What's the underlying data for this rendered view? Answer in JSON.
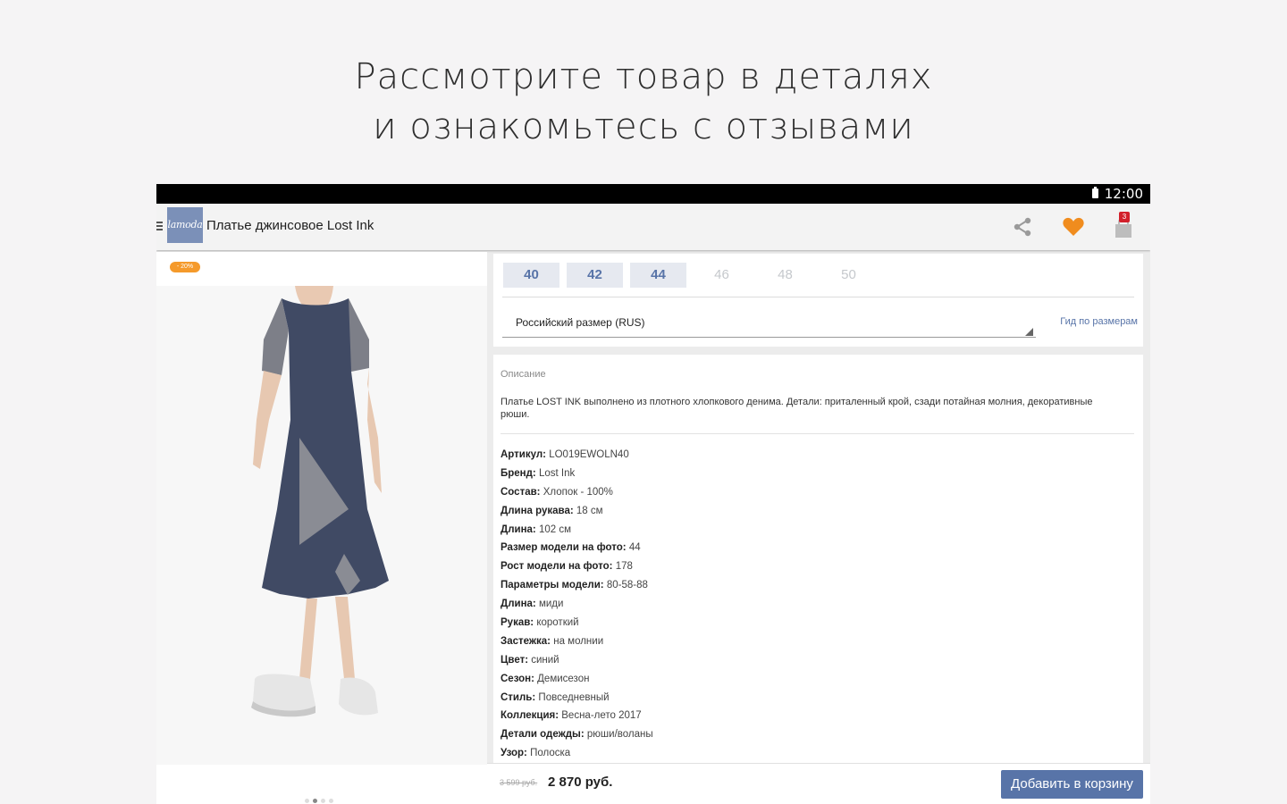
{
  "promo": {
    "line1": "Рассмотрите товар в деталях",
    "line2": "и ознакомьтесь с отзывами"
  },
  "status_bar": {
    "time": "12:00"
  },
  "app_bar": {
    "logo_text": "lamoda",
    "title": "Платье джинсовое Lost Ink",
    "cart_count": "3",
    "icons": [
      "menu-icon",
      "share-icon",
      "heart-icon",
      "cart-icon"
    ],
    "heart_color": "#f08c1e"
  },
  "product": {
    "discount": "- 20%",
    "gallery_pages": 4,
    "gallery_active_page": 2
  },
  "sizes": {
    "options": [
      {
        "label": "40",
        "available": true
      },
      {
        "label": "42",
        "available": true
      },
      {
        "label": "44",
        "available": true
      },
      {
        "label": "46",
        "available": false
      },
      {
        "label": "48",
        "available": false
      },
      {
        "label": "50",
        "available": false
      }
    ],
    "system_label": "Российский размер (RUS)",
    "guide_link": "Гид по размерам"
  },
  "description": {
    "title": "Описание",
    "text": "Платье LOST INK выполнено из плотного хлопкового денима. Детали: приталенный крой, сзади потайная молния, декоративные рюши.",
    "specs": [
      {
        "label": "Артикул:",
        "value": "LO019EWOLN40"
      },
      {
        "label": "Бренд:",
        "value": "Lost Ink"
      },
      {
        "label": "Состав:",
        "value": "Хлопок - 100%"
      },
      {
        "label": "Длина рукава:",
        "value": "18 см"
      },
      {
        "label": "Длина:",
        "value": "102 см"
      },
      {
        "label": "Размер модели на фото:",
        "value": "44"
      },
      {
        "label": "Рост модели на фото:",
        "value": "178"
      },
      {
        "label": "Параметры модели:",
        "value": "80-58-88"
      },
      {
        "label": "Длина:",
        "value": "миди"
      },
      {
        "label": "Рукав:",
        "value": "короткий"
      },
      {
        "label": "Застежка:",
        "value": "на молнии"
      },
      {
        "label": "Цвет:",
        "value": "синий"
      },
      {
        "label": "Сезон:",
        "value": "Демисезон"
      },
      {
        "label": "Стиль:",
        "value": "Повседневный"
      },
      {
        "label": "Коллекция:",
        "value": "Весна-лето 2017"
      },
      {
        "label": "Детали одежды:",
        "value": "рюши/воланы"
      },
      {
        "label": "Узор:",
        "value": "Полоска"
      }
    ]
  },
  "price": {
    "old": "3 599 руб.",
    "new": "2 870 руб."
  },
  "add_to_cart": "Добавить в корзину",
  "colors": {
    "accent": "#5874a8",
    "discount": "#f59a2b",
    "badge": "#d2202b"
  }
}
